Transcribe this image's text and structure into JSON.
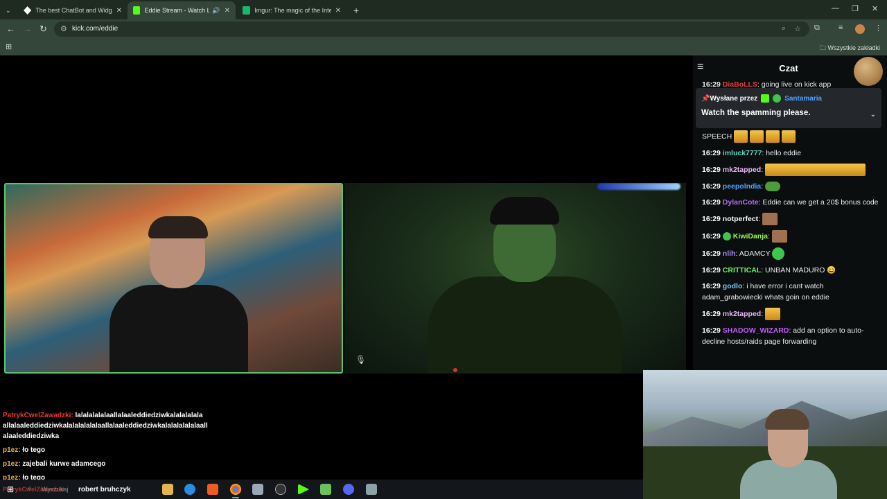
{
  "browser": {
    "tabs": [
      {
        "title": "The best ChatBot and Widgets",
        "active": false,
        "favicon_color": "#ffffff"
      },
      {
        "title": "Eddie Stream - Watch Live",
        "active": true,
        "favicon_color": "#53fc18"
      },
      {
        "title": "Imgur: The magic of the Interne",
        "active": false,
        "favicon_color": "#1bb76e"
      }
    ],
    "new_tab": "+",
    "url": "kick.com/eddie",
    "bookmarks_all": "Wszystkie zakładki"
  },
  "overlay_chat": [
    {
      "user": "PatrykCwelZawadzki:",
      "text": "lalalalalalaallalaaleddiedziwkalalalalala allalaaleddiedziwkalalalalalalaallalaaleddiedziwkalalalalalalaall alaaleddiedziwka",
      "color": "#e33b3b"
    },
    {
      "user": "p1ez:",
      "text": "ło tego",
      "color": "#f0b24a"
    },
    {
      "user": "p1ez:",
      "text": "zajebali kurwe adamcego",
      "color": "#f0b24a"
    },
    {
      "user": "p1ez:",
      "text": "ło tego",
      "color": "#f0b24a"
    }
  ],
  "chat": {
    "title": "Czat",
    "partial_top": {
      "time": "16:29",
      "user": "DiaBoLLS",
      "text": ": going live on kick app"
    },
    "pinned": {
      "label": "Wysłane przez",
      "user": "Santamaria",
      "message": "Watch the spamming please."
    },
    "messages": [
      {
        "time": "",
        "user": "",
        "color": "#ffffff",
        "text": "SPEECH",
        "emote": "gold-small"
      },
      {
        "time": "16:29",
        "user": "imluck7777",
        "color": "#5fd7c0",
        "text": ": hello eddie",
        "emote": ""
      },
      {
        "time": "16:29",
        "user": "mk2tapped",
        "color": "#e8b8f5",
        "text": ":",
        "emote": "gold-wide"
      },
      {
        "time": "16:29",
        "user": "peepolndia",
        "color": "#4ea3ff",
        "text": ":",
        "emote": "frog"
      },
      {
        "time": "16:29",
        "user": "DylanCote",
        "color": "#b76ef2",
        "text": ": Eddie can we get a 20$ bonus code",
        "emote": ""
      },
      {
        "time": "16:29",
        "user": "notperfect",
        "color": "#ffffff",
        "text": ":",
        "emote": "face"
      },
      {
        "time": "16:29",
        "user": "KiwiDanja",
        "color": "#9cf55a",
        "text": ":",
        "emote": "face"
      },
      {
        "time": "16:29",
        "user": "nlih",
        "color": "#a88cf7",
        "text": ": ADAMCY",
        "emote": "green"
      },
      {
        "time": "16:29",
        "user": "CRITTICAL",
        "color": "#6ef06e",
        "text": ": UNBAN MADURO 😄",
        "emote": ""
      },
      {
        "time": "16:29",
        "user": "godlo",
        "color": "#78c8f0",
        "text": ": i have error i cant watch adam_grabowiecki whats goin on eddie",
        "emote": ""
      },
      {
        "time": "16:29",
        "user": "mk2tapped",
        "color": "#e8b8f5",
        "text": ":",
        "emote": "gold-small"
      },
      {
        "time": "16:29",
        "user": "SHADOW_WIZARD",
        "color": "#c05cf5",
        "text": ": add an option to auto-decline hosts/raids page forwarding",
        "emote": ""
      }
    ]
  },
  "taskbar": {
    "search_label": "Wyszukaj",
    "ghost_text": "PatrykCwelZawadzki",
    "user": "robert bruhczyk"
  }
}
